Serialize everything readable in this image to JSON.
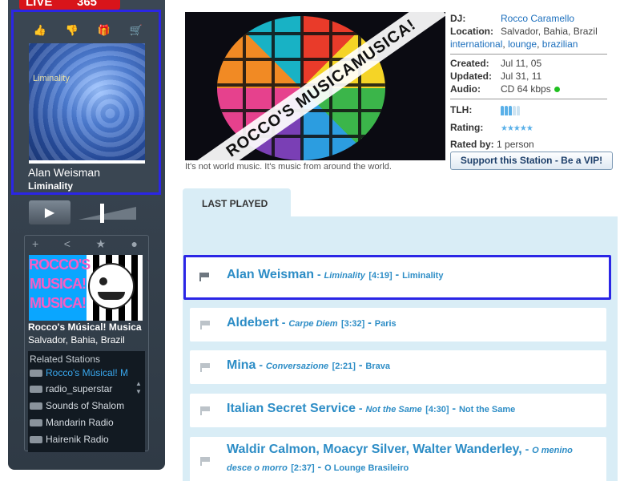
{
  "player": {
    "logo_left": "LIVE",
    "logo_right": "365",
    "actions": [
      "thumb-up-icon",
      "thumb-down-icon",
      "gift-icon",
      "cart-icon"
    ],
    "now_playing": {
      "artist": "Alan Weisman",
      "album": "Liminality",
      "cover_text": "Liminality",
      "progress": 1.0
    },
    "volume_level": 0.4,
    "station_actions": [
      "plus-icon",
      "share-icon",
      "star-icon",
      "chat-icon"
    ],
    "station": {
      "name": "Rocco's Músical! Musica",
      "location": "Salvador, Bahia, Brazil",
      "logo_text": "ROCCO'S MUSICA! MUSICA!"
    },
    "related": {
      "title": "Related Stations",
      "items": [
        "Rocco's Músical! M",
        "radio_superstar",
        "Sounds of Shalom",
        "Mandarin Radio",
        "Hairenik Radio"
      ]
    }
  },
  "artwork": {
    "banner_text": "ROCCO'S MUSICAMUSICA!",
    "caption": "It's not world music. It's music from around the world."
  },
  "info": {
    "dj_label": "DJ:",
    "dj": "Rocco Caramello",
    "location_label": "Location:",
    "location": "Salvador, Bahia, Brazil",
    "tags": [
      "international",
      "lounge",
      "brazilian"
    ],
    "created_label": "Created:",
    "created": "Jul 11, 05",
    "updated_label": "Updated:",
    "updated": "Jul 31, 11",
    "audio_label": "Audio:",
    "audio": "CD 64 kbps",
    "tlh_label": "TLH:",
    "tlh_level": 3,
    "tlh_max": 5,
    "rating_label": "Rating:",
    "rating": 5,
    "rating_max": 5,
    "rated_by_label": "Rated by:",
    "rated_by": "1 person",
    "vip_button": "Support this Station - Be a VIP!"
  },
  "last_played": {
    "tab": "LAST PLAYED",
    "tracks": [
      {
        "artist": "Alan Weisman",
        "title": "Liminality",
        "duration": "[4:19]",
        "album": "Liminality"
      },
      {
        "artist": "Aldebert",
        "title": "Carpe Diem",
        "duration": "[3:32]",
        "album": "Paris"
      },
      {
        "artist": "Mina",
        "title": "Conversazione",
        "duration": "[2:21]",
        "album": "Brava"
      },
      {
        "artist": "Italian Secret Service",
        "title": "Not the Same",
        "duration": "[4:30]",
        "album": "Not the Same"
      },
      {
        "artist": "Waldir Calmon, Moacyr Silver, Walter Wanderley,",
        "title": "O menino desce o morro",
        "duration": "[2:37]",
        "album": "O Lounge Brasileiro"
      }
    ]
  }
}
